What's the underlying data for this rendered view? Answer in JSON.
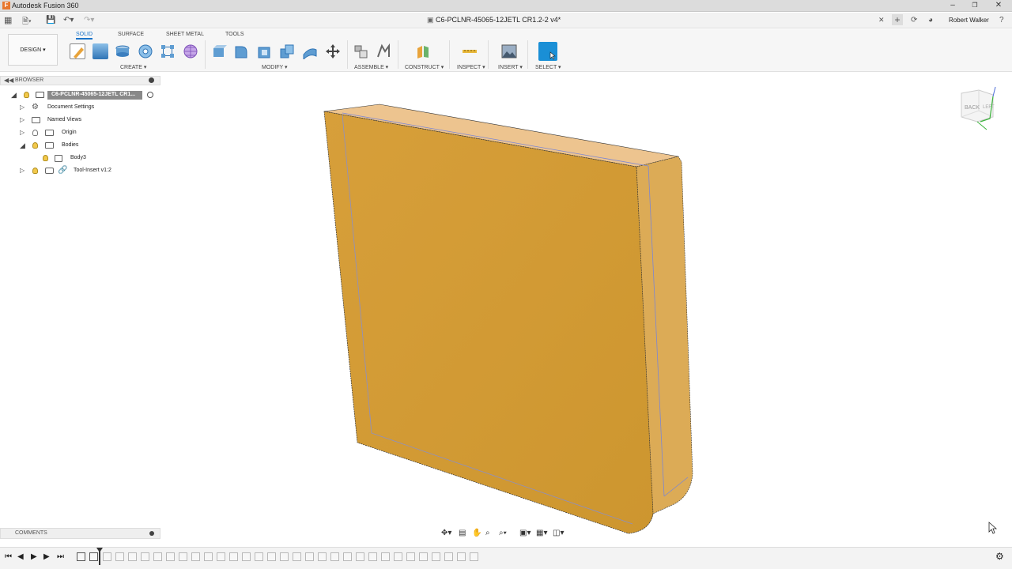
{
  "window": {
    "app_title": "Autodesk Fusion 360"
  },
  "document": {
    "tab_title": "C6-PCLNR-45065-12JETL CR1.2-2 v4*"
  },
  "user": {
    "name": "Robert Walker"
  },
  "workspace": {
    "label": "DESIGN ▾"
  },
  "tabs": [
    "SOLID",
    "SURFACE",
    "SHEET METAL",
    "TOOLS"
  ],
  "groups": [
    "CREATE ▾",
    "MODIFY ▾",
    "ASSEMBLE ▾",
    "CONSTRUCT ▾",
    "INSPECT ▾",
    "INSERT ▾",
    "SELECT ▾"
  ],
  "browser": {
    "header": "BROWSER",
    "root": "C6-PCLNR-45065-12JETL CR1...",
    "items": [
      "Document Settings",
      "Named Views",
      "Origin",
      "Bodies",
      "Body3",
      "Tool-Insert v1:2"
    ]
  },
  "comments": {
    "header": "COMMENTS"
  },
  "viewcube": {
    "back": "BACK",
    "left": "LEFT"
  },
  "colors": {
    "accent": "#1a73c8",
    "body_fill": "#d29a38",
    "select_active": "#1a8fd6"
  }
}
